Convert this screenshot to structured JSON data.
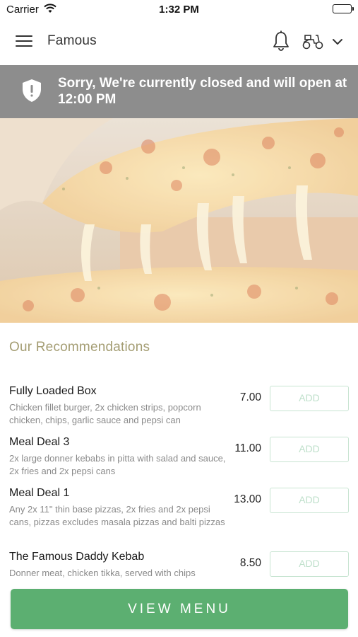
{
  "status_bar": {
    "carrier": "Carrier",
    "time": "1:32 PM"
  },
  "nav": {
    "title": "Famous"
  },
  "banner": {
    "message": "Sorry, We're currently closed and will open at 12:00 PM"
  },
  "section": {
    "title": "Our Recommendations"
  },
  "items": [
    {
      "name": "Fully Loaded Box",
      "description": "Chicken fillet burger, 2x chicken strips, popcorn chicken, chips, garlic sauce and pepsi can",
      "price": "7.00",
      "add_label": "ADD"
    },
    {
      "name": "Meal Deal 3",
      "description": "2x large donner kebabs in pitta with salad and sauce, 2x fries and 2x pepsi cans",
      "price": "11.00",
      "add_label": "ADD"
    },
    {
      "name": "Meal Deal 1",
      "description": "Any 2x 11\" thin base pizzas, 2x fries and 2x pepsi cans, pizzas excludes masala pizzas and balti pizzas",
      "price": "13.00",
      "add_label": "ADD"
    },
    {
      "name": "The Famous Daddy Kebab",
      "description": "Donner meat, chicken tikka, served with chips",
      "price": "8.50",
      "add_label": "ADD"
    }
  ],
  "footer": {
    "view_menu_label": "VIEW MENU"
  },
  "colors": {
    "accent_green": "#5caf71",
    "banner_gray": "#8d8d8d",
    "section_title": "#a49d73",
    "add_border": "#c7e4d1"
  }
}
